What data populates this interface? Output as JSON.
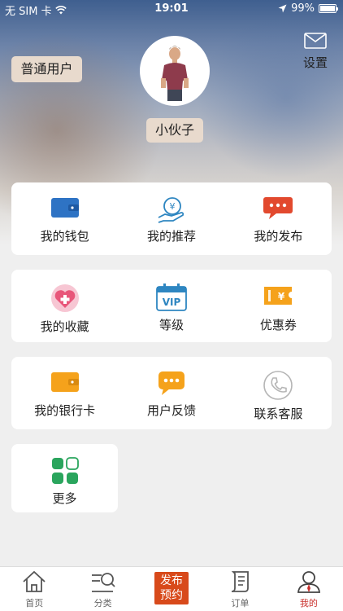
{
  "status": {
    "carrier": "无 SIM 卡",
    "time": "19:01",
    "battery_text": "99%",
    "battery_level": 0.99
  },
  "header": {
    "user_type": "普通用户",
    "settings_label": "设置",
    "nickname": "小伙子"
  },
  "menu": {
    "row1": [
      {
        "label": "我的钱包",
        "icon": "wallet-icon"
      },
      {
        "label": "我的推荐",
        "icon": "recommend-icon"
      },
      {
        "label": "我的发布",
        "icon": "message-icon"
      }
    ],
    "row2": [
      {
        "label": "我的收藏",
        "icon": "heart-plus-icon"
      },
      {
        "label": "等级",
        "icon": "vip-calendar-icon"
      },
      {
        "label": "优惠券",
        "icon": "coupon-icon"
      }
    ],
    "row3": [
      {
        "label": "我的银行卡",
        "icon": "bank-card-icon"
      },
      {
        "label": "用户反馈",
        "icon": "feedback-icon"
      },
      {
        "label": "联系客服",
        "icon": "phone-icon"
      }
    ],
    "more": {
      "label": "更多",
      "icon": "grid-icon"
    }
  },
  "tabbar": [
    {
      "label": "首页",
      "icon": "home-icon"
    },
    {
      "label": "分类",
      "icon": "category-icon"
    },
    {
      "label": "发布预约",
      "icon": "publish-button"
    },
    {
      "label": "订单",
      "icon": "order-icon"
    },
    {
      "label": "我的",
      "icon": "profile-icon"
    }
  ],
  "colors": {
    "wallet": "#2e73c4",
    "orange": "#f5a21b",
    "pink": "#e8567a",
    "coupon": "#f5a21b",
    "message": "#e2492e",
    "green": "#2aa55d",
    "accent": "#c9302c",
    "publish": "#d84a1b"
  }
}
